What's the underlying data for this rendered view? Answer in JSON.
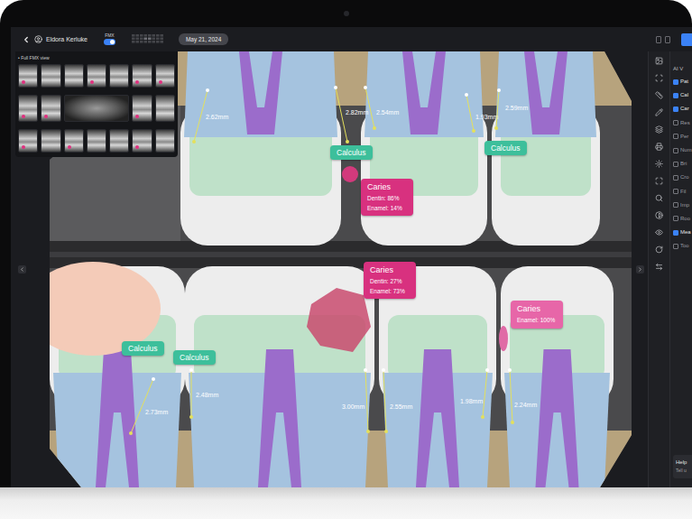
{
  "header": {
    "patient": "Eldora Kerluke",
    "mode": {
      "label": "FMX",
      "on": true
    },
    "date": "May 21, 2024"
  },
  "fmx_panel": {
    "title": "• Full FMX view",
    "rows": [
      [
        {
          "kind": "periapical",
          "findings": true,
          "selected": false
        },
        {
          "kind": "periapical",
          "findings": false,
          "selected": false
        },
        {
          "kind": "periapical",
          "findings": false,
          "selected": false
        },
        {
          "kind": "periapical",
          "findings": true,
          "selected": false
        },
        {
          "kind": "periapical",
          "findings": false,
          "selected": false
        },
        {
          "kind": "periapical",
          "findings": true,
          "selected": false
        },
        {
          "kind": "periapical",
          "findings": true,
          "selected": false
        }
      ],
      [
        {
          "kind": "bitewing",
          "findings": true,
          "selected": false
        },
        {
          "kind": "bitewing",
          "findings": true,
          "selected": false
        },
        {
          "kind": "panoramic",
          "findings": false,
          "selected": false
        },
        {
          "kind": "bitewing",
          "findings": true,
          "selected": false
        },
        {
          "kind": "bitewing",
          "findings": false,
          "selected": false
        }
      ],
      [
        {
          "kind": "periapical",
          "findings": true,
          "selected": false
        },
        {
          "kind": "periapical",
          "findings": false,
          "selected": false
        },
        {
          "kind": "periapical",
          "findings": true,
          "selected": false
        },
        {
          "kind": "periapical",
          "findings": false,
          "selected": false
        },
        {
          "kind": "periapical",
          "findings": false,
          "selected": false
        },
        {
          "kind": "periapical",
          "findings": true,
          "selected": false
        },
        {
          "kind": "periapical",
          "findings": false,
          "selected": false
        }
      ]
    ]
  },
  "findings": [
    {
      "kind": "calculus",
      "label": "Calculus",
      "color": "#3dbf9b",
      "details": []
    },
    {
      "kind": "caries",
      "label": "Caries",
      "color": "#d8317f",
      "details": [
        "Dentin: 86%",
        "Enamel: 14%"
      ]
    },
    {
      "kind": "calculus",
      "label": "Calculus",
      "color": "#3dbf9b",
      "details": []
    },
    {
      "kind": "caries",
      "label": "Caries",
      "color": "#d8317f",
      "details": [
        "Dentin: 27%",
        "Enamel: 73%"
      ]
    },
    {
      "kind": "caries",
      "label": "Caries",
      "color": "#e766a8",
      "details": [
        "Enamel: 100%"
      ]
    },
    {
      "kind": "calculus",
      "label": "Calculus",
      "color": "#3dbf9b",
      "details": []
    },
    {
      "kind": "calculus",
      "label": "Calculus",
      "color": "#3dbf9b",
      "details": []
    }
  ],
  "measurements": [
    "2.62mm",
    "2.82mm",
    "2.54mm",
    "1.93mm",
    "2.59mm",
    "2.73mm",
    "2.48mm",
    "3.00mm",
    "2.55mm",
    "1.98mm",
    "2.24mm"
  ],
  "side_panel": {
    "title": "AI V",
    "layers": [
      {
        "label": "Pat",
        "checked": true
      },
      {
        "label": "Cal",
        "checked": true
      },
      {
        "label": "Car",
        "checked": true
      },
      {
        "label": "Res",
        "checked": false
      },
      {
        "label": "Per",
        "checked": false
      },
      {
        "label": "Num",
        "checked": false
      },
      {
        "label": "Bri",
        "checked": false
      },
      {
        "label": "Cro",
        "checked": false
      },
      {
        "label": "Fil",
        "checked": false
      },
      {
        "label": "Imp",
        "checked": false
      },
      {
        "label": "Roo",
        "checked": false
      },
      {
        "label": "Mea",
        "checked": true
      },
      {
        "label": "Too",
        "checked": false
      }
    ],
    "help": {
      "title": "Help",
      "text": "Tell u"
    }
  }
}
